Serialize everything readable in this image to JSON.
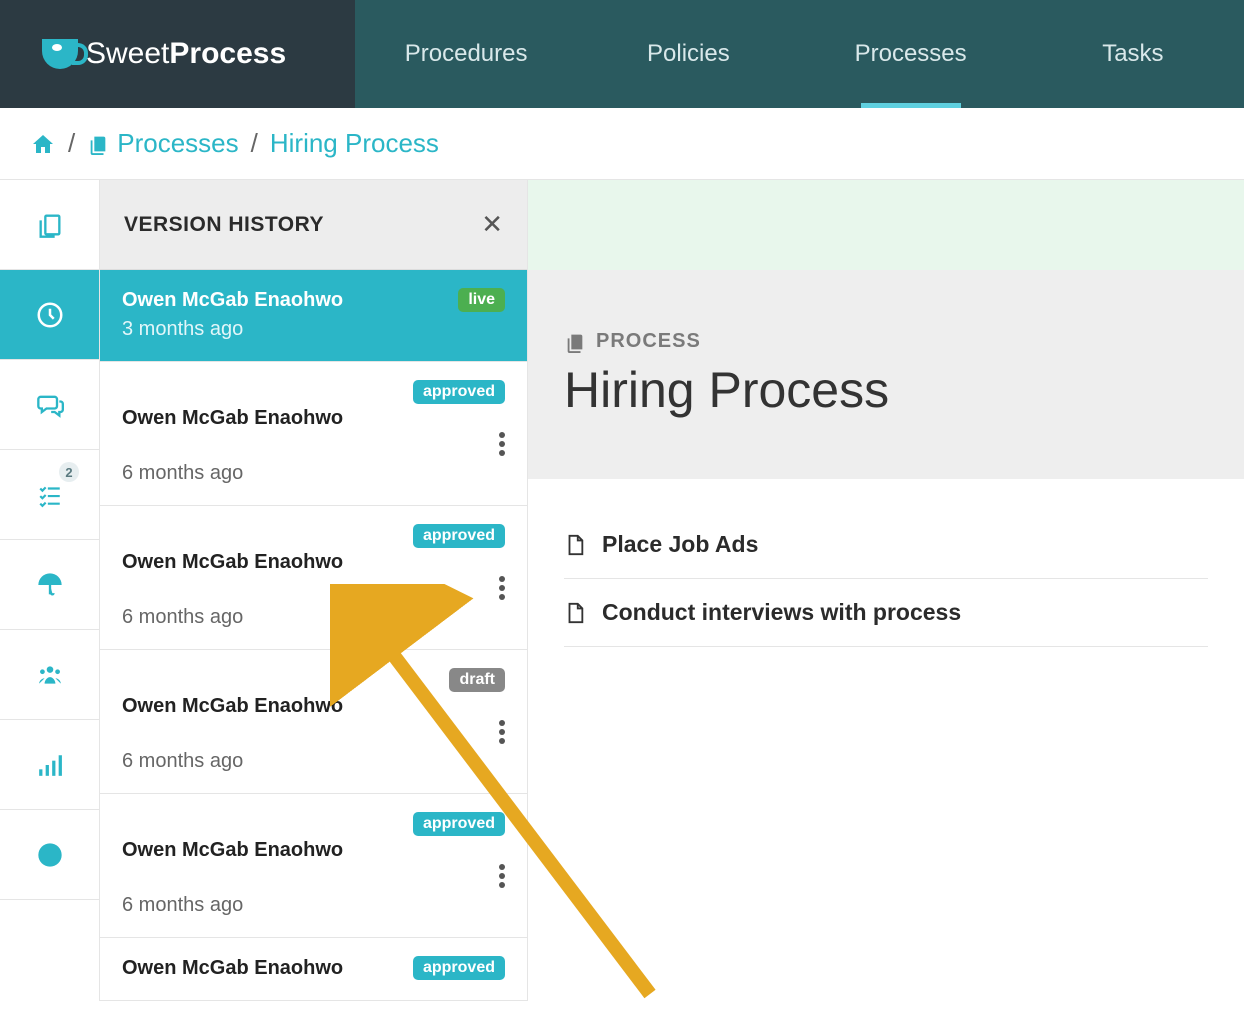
{
  "logo": {
    "brand1": "Sweet",
    "brand2": "Process"
  },
  "nav": {
    "items": [
      {
        "label": "Procedures",
        "active": false
      },
      {
        "label": "Policies",
        "active": false
      },
      {
        "label": "Processes",
        "active": true
      },
      {
        "label": "Tasks",
        "active": false
      }
    ]
  },
  "breadcrumb": {
    "section": "Processes",
    "current": "Hiring Process"
  },
  "rail": {
    "badge_count": "2"
  },
  "version_history": {
    "title": "VERSION HISTORY",
    "items": [
      {
        "name": "Owen McGab Enaohwo",
        "time": "3 months ago",
        "status": "live",
        "status_class": "badge-live",
        "active": true,
        "has_more": false
      },
      {
        "name": "Owen McGab Enaohwo",
        "time": "6 months ago",
        "status": "approved",
        "status_class": "badge-approved",
        "active": false,
        "has_more": true
      },
      {
        "name": "Owen McGab Enaohwo",
        "time": "6 months ago",
        "status": "approved",
        "status_class": "badge-approved",
        "active": false,
        "has_more": true
      },
      {
        "name": "Owen McGab Enaohwo",
        "time": "6 months ago",
        "status": "draft",
        "status_class": "badge-draft",
        "active": false,
        "has_more": true
      },
      {
        "name": "Owen McGab Enaohwo",
        "time": "6 months ago",
        "status": "approved",
        "status_class": "badge-approved",
        "active": false,
        "has_more": true
      },
      {
        "name": "Owen McGab Enaohwo",
        "time": "",
        "status": "approved",
        "status_class": "badge-approved",
        "active": false,
        "has_more": false
      }
    ]
  },
  "main": {
    "label": "PROCESS",
    "title": "Hiring Process",
    "steps": [
      {
        "label": "Place Job Ads"
      },
      {
        "label": "Conduct interviews with process"
      }
    ]
  }
}
